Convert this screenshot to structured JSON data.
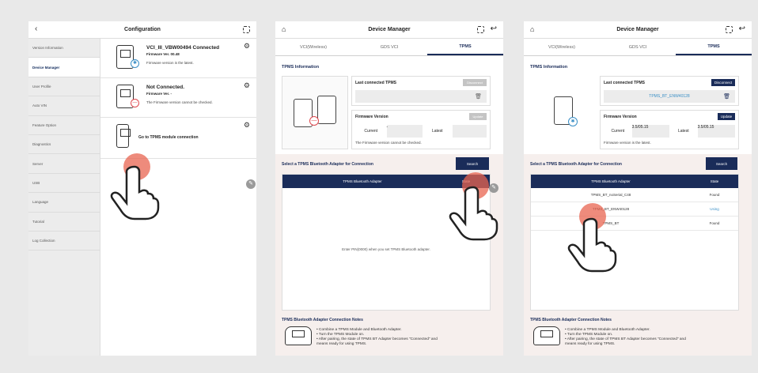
{
  "panel1": {
    "title": "Configuration",
    "sidebar": [
      "Version Information",
      "Device Manager",
      "User Profile",
      "Auto VIN",
      "Feature Option",
      "Diagnostics",
      "Server",
      "USB",
      "Language",
      "Tutorial",
      "Log Collection"
    ],
    "devices": {
      "vci_name": "VCI_III_VBW00494 Connected",
      "vci_fw": "Firmware Ver. 00.48",
      "vci_msg": "Firmware version is the latest.",
      "nc_name": "Not Connected.",
      "nc_fw": "Firmware Ver. -",
      "nc_msg": "The Firmware version cannot be checked.",
      "goto": "Go to TPMS module connection"
    }
  },
  "panel2": {
    "title": "Device Manager",
    "tabs": [
      "VCI(Wireless)",
      "GDS VCI",
      "TPMS"
    ],
    "tpms_info": "TPMS Information",
    "last_connected": "Last connected TPMS",
    "disconnect": "Disconnect",
    "last_value": "",
    "fw_version": "Firmware Version",
    "update": "Update",
    "current_label": "Current",
    "current_value": "-",
    "latest_label": "Latest",
    "latest_value": "",
    "fw_note": "The Firmware version cannot be checked.",
    "select_label": "Select a TPMS Bluetooth Adapter for Connection",
    "search": "Search",
    "col_adapter": "TPMS Bluetooth Adapter",
    "col_state": "State",
    "empty_msg": "Enter PIN(0000) when you set TPMS Bluetooth adapter.",
    "notes_title": "TPMS Bluetooth Adapter Connection Notes",
    "notes": [
      "• Combine a TPMS Module and Bluetooth Adapter.",
      "• Turn the TPMS Module on.",
      "• After pairing, the state of TPMS BT Adapter becomes \"Connected\" and",
      "  means ready for using TPMS."
    ]
  },
  "panel3": {
    "title": "Device Manager",
    "tabs": [
      "VCI(Wireless)",
      "GDS VCI",
      "TPMS"
    ],
    "tpms_info": "TPMS Information",
    "last_connected": "Last connected TPMS",
    "disconnect": "Disconnect",
    "last_value": "TPMS_BT_ENW40128",
    "fw_version": "Firmware Version",
    "update": "Update",
    "current_label": "Current",
    "current_value": "3.5/05.15",
    "latest_label": "Latest",
    "latest_value": "3.5/05.15",
    "fw_note": "Firmware version is the latest.",
    "select_label": "Select a TPMS Bluetooth Adapter for Connection",
    "search": "Search",
    "col_adapter": "TPMS Bluetooth Adapter",
    "col_state": "State",
    "rows": [
      {
        "name": "TPMS_BT_noSerial_C48",
        "state": "Found"
      },
      {
        "name": "TPMS_BT_ENW40128",
        "state": "Using"
      },
      {
        "name": "TPMS_BT",
        "state": "Found"
      }
    ],
    "notes_title": "TPMS Bluetooth Adapter Connection Notes",
    "notes": [
      "• Combine a TPMS Module and Bluetooth Adapter.",
      "• Turn the TPMS Module on.",
      "• After pairing, the state of TPMS BT Adapter becomes \"Connected\" and",
      "  means ready for using TPMS."
    ]
  },
  "colors": {
    "navy": "#1a2c59",
    "accent_blue": "#3a8fc6",
    "touch": "#e86450",
    "warn_red": "#e0494f"
  },
  "icons": [
    "back-icon",
    "home-icon",
    "scan-icon",
    "exit-icon",
    "gear-icon",
    "bluetooth-icon",
    "trash-icon",
    "hand-pointer-icon"
  ]
}
